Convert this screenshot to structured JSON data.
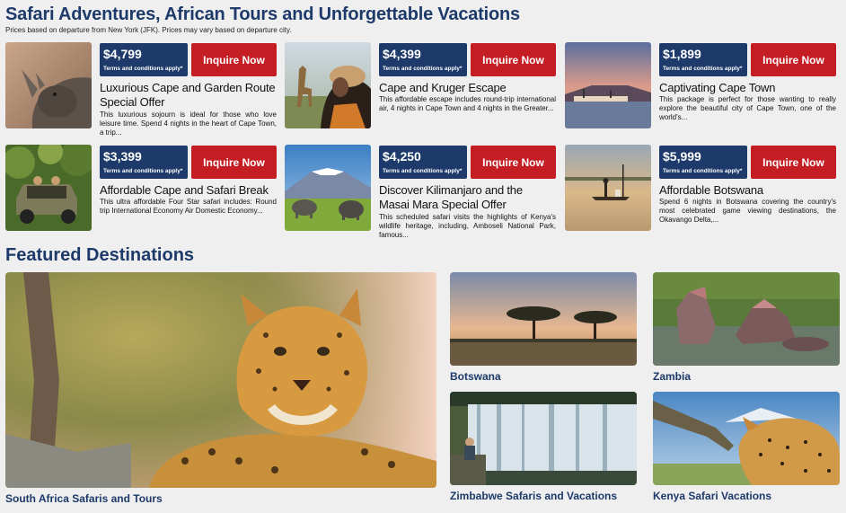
{
  "header": {
    "title": "Safari Adventures, African Tours and Unforgettable Vacations",
    "subtitle": "Prices based on departure from New York (JFK).  Prices may vary based on departure city."
  },
  "offers": [
    {
      "price": "$4,799",
      "terms": "Terms and conditions apply*",
      "inquire": "Inquire Now",
      "name": "Luxurious Cape and Garden Route Special Offer",
      "desc": "This luxurious sojourn is ideal for those who love leisure time. Spend 4 nights in the heart of Cape Town, a trip...",
      "image": "rhino-photo"
    },
    {
      "price": "$4,399",
      "terms": "Terms and conditions apply*",
      "inquire": "Inquire Now",
      "name": "Cape and Kruger Escape",
      "desc": "This affordable escape includes round-trip international air, 4 nights in Cape Town and 4 nights in the Greater...",
      "image": "giraffe-woman-photo"
    },
    {
      "price": "$1,899",
      "terms": "Terms and conditions apply*",
      "inquire": "Inquire Now",
      "name": "Captivating Cape Town",
      "desc": "This package is perfect for those wanting to really explore the beautiful city of Cape Town, one of the world's...",
      "image": "cape-town-harbour-photo"
    },
    {
      "price": "$3,399",
      "terms": "Terms and conditions apply*",
      "inquire": "Inquire Now",
      "name": "Affordable Cape and Safari Break",
      "desc": "This ultra affordable Four Star safari includes: Round trip International Economy Air Domestic Economy...",
      "image": "safari-jeep-photo"
    },
    {
      "price": "$4,250",
      "terms": "Terms and conditions apply*",
      "inquire": "Inquire Now",
      "name": "Discover Kilimanjaro and the Masai Mara Special Offer",
      "desc": "This scheduled safari visits the highlights of Kenya's wildlife heritage, including, Amboseli National Park, famous...",
      "image": "kilimanjaro-elephants-photo"
    },
    {
      "price": "$5,999",
      "terms": "Terms and conditions apply*",
      "inquire": "Inquire Now",
      "name": "Affordable Botswana",
      "desc": "Spend 6 nights in Botswana covering the country's most celebrated game viewing destinations, the Okavango Delta,...",
      "image": "okavango-mokoro-photo"
    }
  ],
  "featured": {
    "title": "Featured Destinations",
    "destinations": [
      {
        "label": "South Africa Safaris and Tours",
        "image": "leopard-photo"
      },
      {
        "label": "Botswana",
        "image": "acacia-sunset-photo"
      },
      {
        "label": "Zambia",
        "image": "hippos-photo"
      },
      {
        "label": "Zimbabwe Safaris and Vacations",
        "image": "victoria-falls-photo"
      },
      {
        "label": "Kenya Safari Vacations",
        "image": "kenya-leopard-photo"
      }
    ]
  },
  "colors": {
    "brand_blue": "#1d3a6a",
    "inquire_red": "#c41e24",
    "background": "#efefef"
  }
}
